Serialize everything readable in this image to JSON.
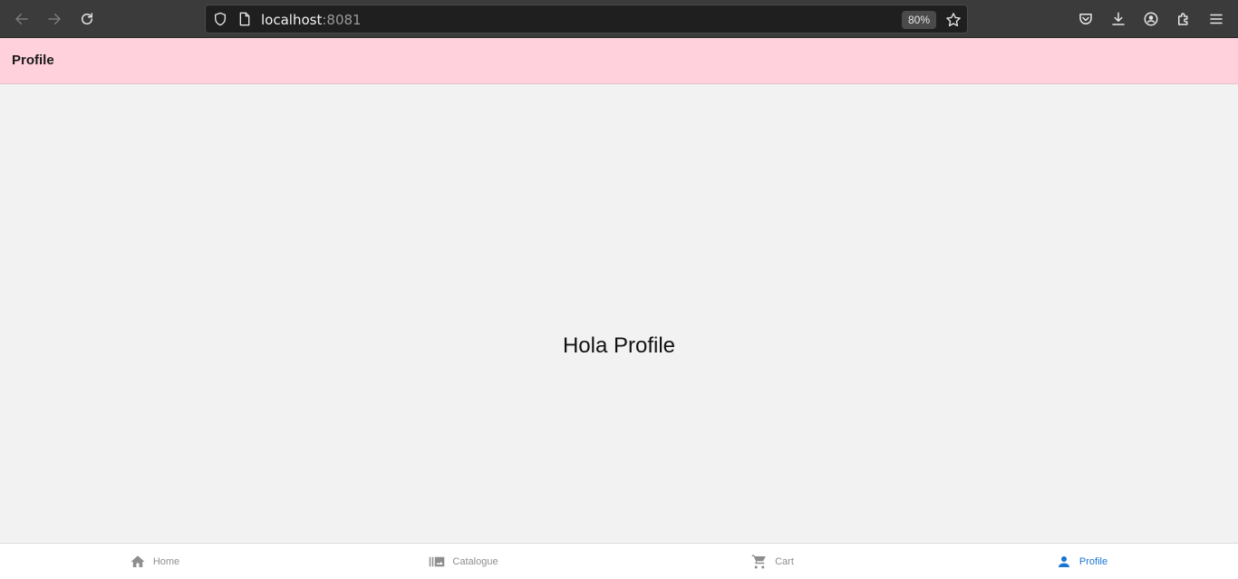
{
  "browser": {
    "url_host": "localhost",
    "url_port": ":8081",
    "zoom": "80%"
  },
  "app": {
    "header_title": "Profile",
    "greeting": "Hola Profile"
  },
  "tabs": [
    {
      "label": "Home",
      "icon": "home-icon",
      "active": false
    },
    {
      "label": "Catalogue",
      "icon": "library-icon",
      "active": false
    },
    {
      "label": "Cart",
      "icon": "cart-icon",
      "active": false
    },
    {
      "label": "Profile",
      "icon": "person-icon",
      "active": true
    }
  ],
  "colors": {
    "header_bg": "#ffd1dc",
    "active_tab": "#1976d2",
    "inactive_tab": "#8e8e8e"
  }
}
